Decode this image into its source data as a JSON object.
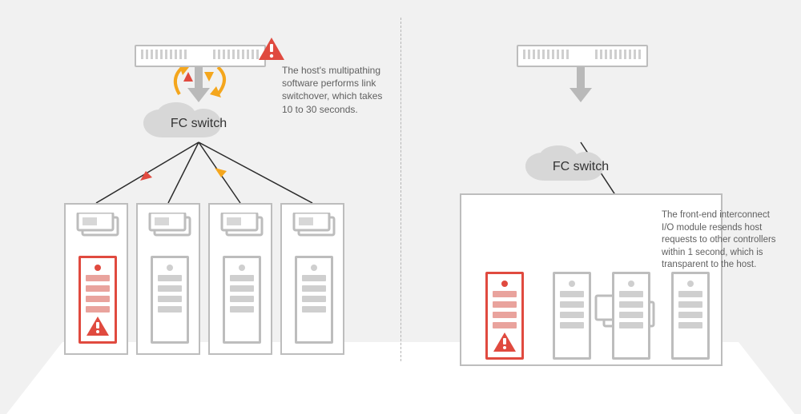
{
  "left": {
    "switch_label": "FC switch",
    "caption": "The host's multipathing software performs link switchover, which takes 10 to 30 seconds."
  },
  "right": {
    "switch_label": "FC switch",
    "caption": "The front-end interconnect I/O module resends host requests to other controllers within 1 second, which is transparent to the host."
  },
  "icons": {
    "alert": "alert-triangle",
    "cloud": "cloud",
    "tower": "controller-tower",
    "host": "rack-host",
    "iomodule": "front-end-io-module"
  },
  "colors": {
    "accent_red": "#e04a3f",
    "accent_amber": "#f4a61d",
    "line": "#2b2b2b",
    "grey": "#bdbdbd"
  }
}
